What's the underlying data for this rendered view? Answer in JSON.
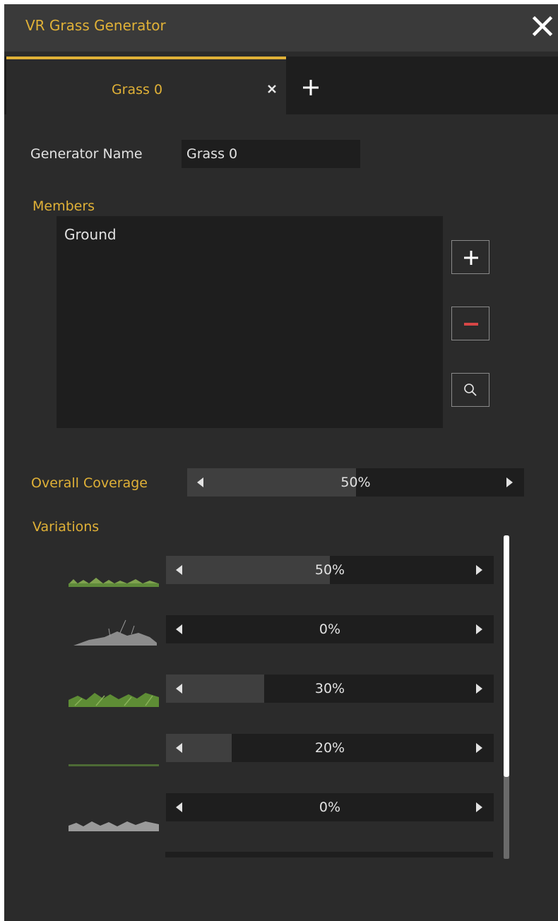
{
  "window": {
    "title": "VR Grass Generator",
    "close_icon": "close-icon"
  },
  "tabs": [
    {
      "label": "Grass 0",
      "active": true
    }
  ],
  "generator": {
    "name_label": "Generator Name",
    "name_value": "Grass 0"
  },
  "members": {
    "label": "Members",
    "items": [
      "Ground"
    ],
    "buttons": [
      "plus-icon",
      "minus-icon",
      "search-icon"
    ]
  },
  "coverage": {
    "label": "Overall Coverage",
    "value": "50%",
    "fraction": 0.5
  },
  "variations": {
    "label": "Variations",
    "items": [
      {
        "value": "50%",
        "fraction": 0.5,
        "thumbnail": "grass-light-thumbnail"
      },
      {
        "value": "0%",
        "fraction": 0.0,
        "thumbnail": "grass-dry-thumbnail"
      },
      {
        "value": "30%",
        "fraction": 0.3,
        "thumbnail": "grass-lush-thumbnail"
      },
      {
        "value": "20%",
        "fraction": 0.2,
        "thumbnail": "grass-thin-thumbnail"
      },
      {
        "value": "0%",
        "fraction": 0.0,
        "thumbnail": "grass-pale-thumbnail"
      }
    ]
  },
  "colors": {
    "accent": "#e0b137",
    "background": "#2b2b2b",
    "field": "#1e1e1e",
    "minus": "#d64646"
  }
}
